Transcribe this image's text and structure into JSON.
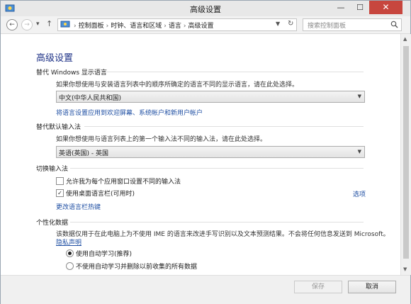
{
  "window": {
    "title": "高级设置",
    "min": "—",
    "max": "☐",
    "close": "✕"
  },
  "nav": {
    "back": "←",
    "forward": "→",
    "recent": "▾",
    "up": "↑",
    "breadcrumbs": [
      "控制面板",
      "时钟、语言和区域",
      "语言",
      "高级设置"
    ],
    "separator": "›",
    "search_placeholder": "搜索控制面板"
  },
  "main": {
    "title": "高级设置",
    "display_language": {
      "header": "替代 Windows 显示语言",
      "desc": "如果你想使用与安装语言列表中的顺序所确定的语言不同的显示语言，请在此处选择。",
      "selected": "中文(中华人民共和国)",
      "apply_link": "将语言设置应用到欢迎屏幕、系统帐户和新用户帐户"
    },
    "default_input": {
      "header": "替代默认输入法",
      "desc": "如果你想使用与语言列表上的第一个输入法不同的输入法，请在此处选择。",
      "selected": "英语(英国) - 英国"
    },
    "switching": {
      "header": "切换输入法",
      "option1": {
        "label": "允许我为每个应用窗口设置不同的输入法",
        "checked": false
      },
      "option2": {
        "label": "使用桌面语言栏(可用时)",
        "checked": true,
        "mark": "✓"
      },
      "options_link": "选项",
      "hotkeys_link": "更改语言栏热键"
    },
    "personalization": {
      "header": "个性化数据",
      "desc": "该数据仅用于在此电脑上为不使用 IME 的语言来改进手写识别以及文本预测结果。不会将任何信息发送到 Microsoft。",
      "privacy_link": "隐私声明",
      "radio1": {
        "label": "使用自动学习(推荐)",
        "selected": true
      },
      "radio2": {
        "label": "不使用自动学习并删除以前收集的所有数据",
        "selected": false
      }
    }
  },
  "footer": {
    "save": "保存",
    "cancel": "取消"
  },
  "colors": {
    "accent_title": "#1e3287",
    "link": "#1f4fa3",
    "close_button": "#c7463e"
  }
}
